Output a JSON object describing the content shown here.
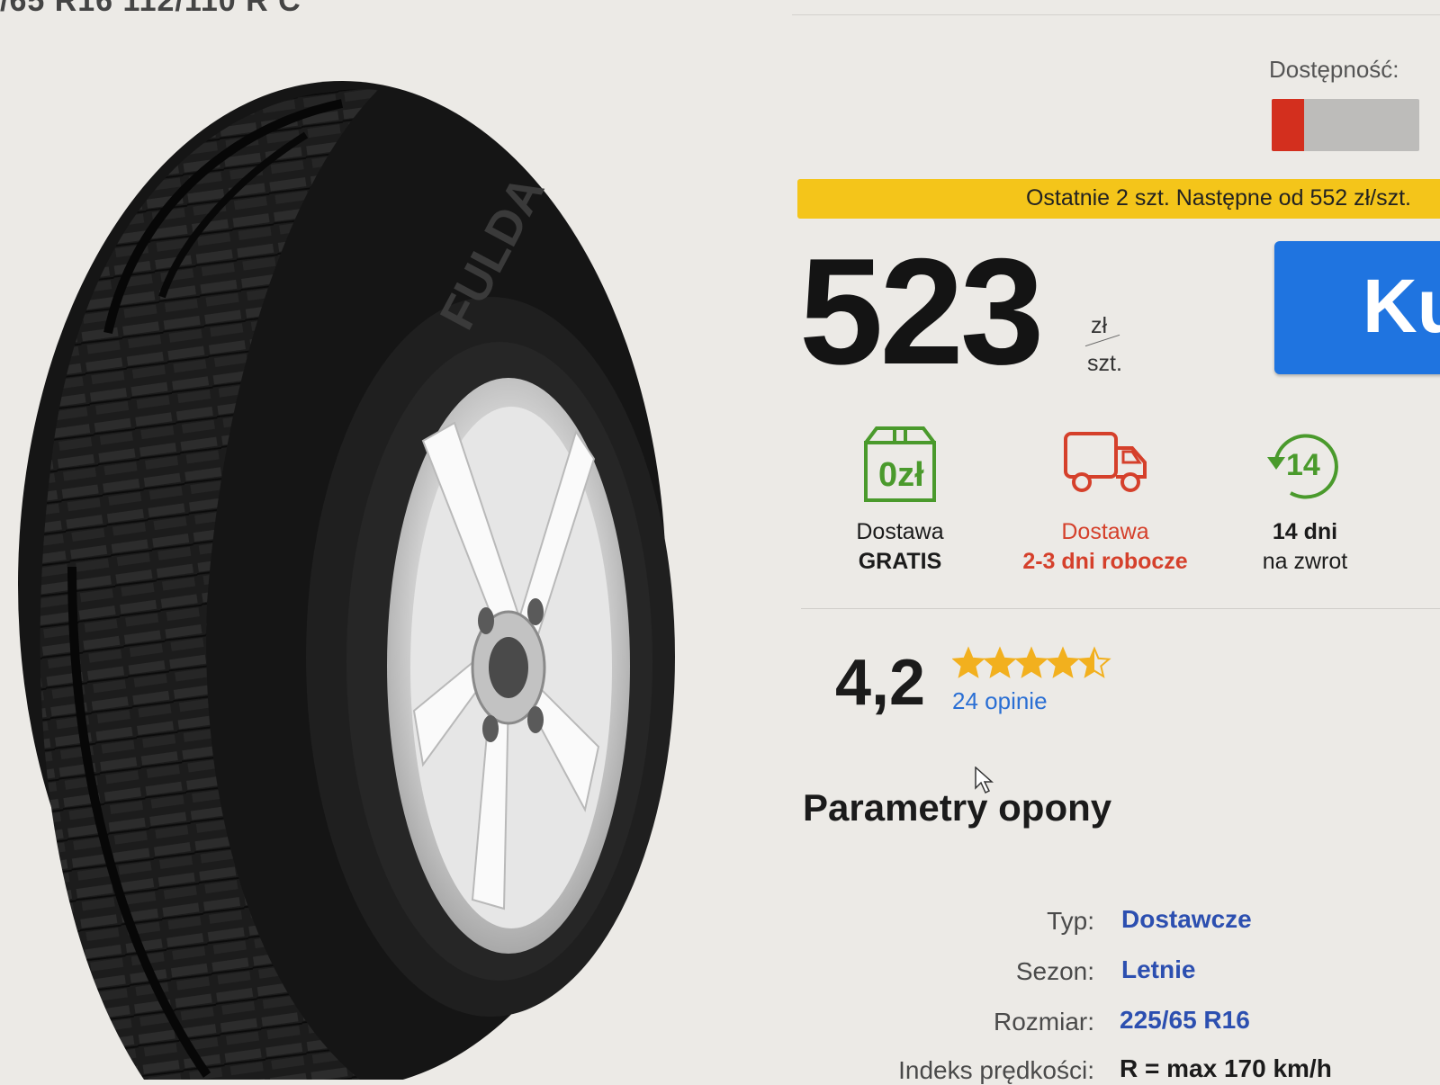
{
  "page": {
    "top_title": "/65 R16 112/110 R C"
  },
  "availability": {
    "label": "Dostępność:",
    "level": 0.22,
    "fill_color": "#d32f1e",
    "empty_color": "#bdbcba"
  },
  "notice": {
    "text": "Ostatnie 2 szt. Następne od 552 zł/szt.",
    "color": "#f4c51a"
  },
  "price": {
    "value": "523",
    "currency": "zł",
    "unit": "szt."
  },
  "buy_button": {
    "label": "Ku",
    "color": "#1f74e0"
  },
  "features": [
    {
      "icon": "box-icon",
      "icon_text": "0zł",
      "line1": "Dostawa",
      "line2": "GRATIS"
    },
    {
      "icon": "truck-icon",
      "line1": "Dostawa",
      "line2": "2-3 dni robocze",
      "color": "#d5402b"
    },
    {
      "icon": "return-14-icon",
      "icon_text": "14",
      "line1": "14 dni",
      "line2": "na zwrot"
    }
  ],
  "rating": {
    "value": "4,2",
    "stars": 4.5,
    "count_text": "24 opinie",
    "star_color": "#f2b01e"
  },
  "params": {
    "title": "Parametry opony",
    "rows": [
      {
        "label": "Typ:",
        "value": "Dostawcze"
      },
      {
        "label": "Sezon:",
        "value": "Letnie"
      },
      {
        "label": "Rozmiar:",
        "value": "225/65 R16"
      },
      {
        "label": "Indeks prędkości:",
        "value": "R = max 170 km/h"
      }
    ]
  }
}
